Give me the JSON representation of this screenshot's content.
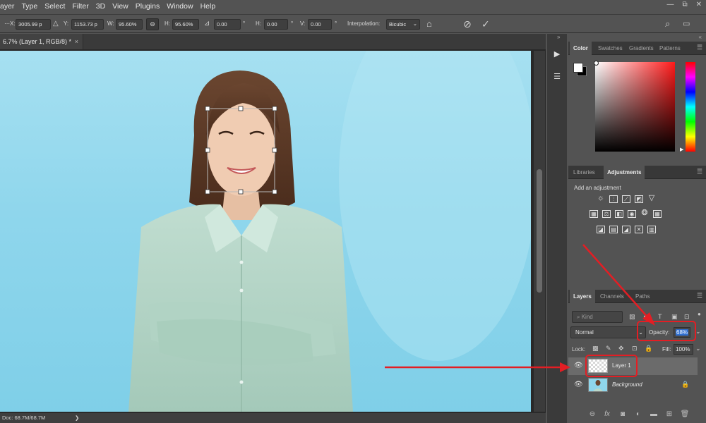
{
  "menu": {
    "items": [
      "ayer",
      "Type",
      "Select",
      "Filter",
      "3D",
      "Plugins",
      "Window",
      "Help"
    ]
  },
  "window_controls": {
    "minimize": "—",
    "restore": "⧉",
    "close": "✕"
  },
  "options_bar": {
    "x_label": "X:",
    "x_value": "3005.99 p",
    "y_label": "Y:",
    "y_value": "1153.73 p",
    "w_label": "W:",
    "w_value": "95.60%",
    "h_label": "H:",
    "h_value": "95.60%",
    "angle_value": "0.00",
    "angle_unit": "°",
    "hskew_label": "H:",
    "hskew_value": "0.00",
    "hskew_unit": "°",
    "vskew_label": "V:",
    "vskew_value": "0.00",
    "vskew_unit": "°",
    "interpolation_label": "Interpolation:",
    "interpolation_value": "Bicubic"
  },
  "document": {
    "tab_title": "6.7% (Layer 1, RGB/8) *",
    "close": "×"
  },
  "status": {
    "doc_info": "Doc: 68.7M/68.7M",
    "arrow": "❯"
  },
  "color_panel": {
    "tabs": [
      "Color",
      "Swatches",
      "Gradients",
      "Patterns"
    ],
    "foreground": "#ffffff",
    "background": "#000000",
    "hue_color": "#ff1a1a"
  },
  "adjustments_panel": {
    "tabs": [
      "Libraries",
      "Adjustments"
    ],
    "hint": "Add an adjustment"
  },
  "layers_panel": {
    "tabs": [
      "Layers",
      "Channels",
      "Paths"
    ],
    "kind_placeholder": "Kind",
    "blend_mode": "Normal",
    "opacity_label": "Opacity:",
    "opacity_value": "68%",
    "lock_label": "Lock:",
    "fill_label": "Fill:",
    "fill_value": "100%",
    "layers": [
      {
        "name": "Layer 1"
      },
      {
        "name": "Background"
      }
    ]
  },
  "annotation_color": "#e31e24"
}
